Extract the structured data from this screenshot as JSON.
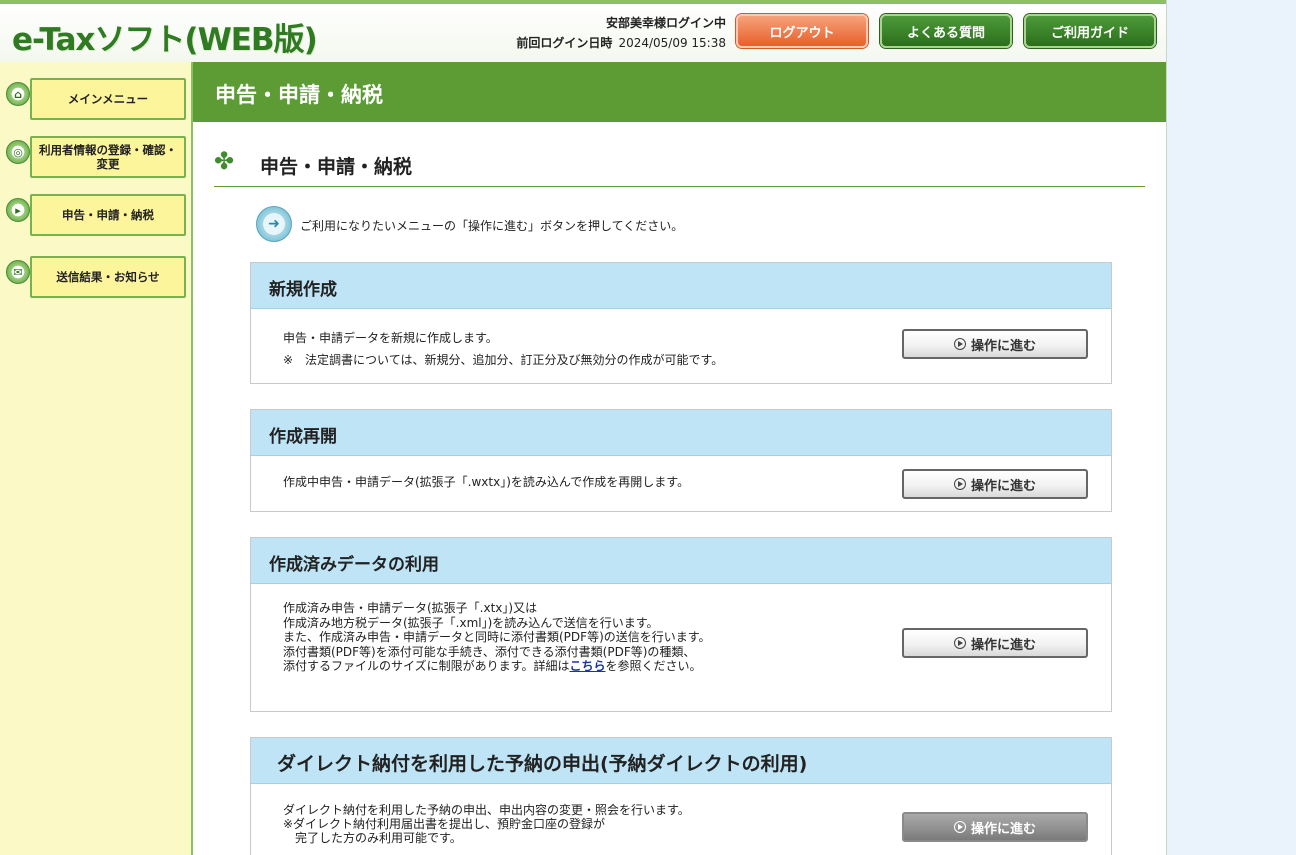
{
  "header": {
    "logo": "e-Taxソフト(WEB版)",
    "user_status": "安部美幸様ログイン中",
    "last_login_label": "前回ログイン日時",
    "last_login_value": "2024/05/09 15:38",
    "logout_label": "ログアウト",
    "faq_label": "よくある質問",
    "guide_label": "ご利用ガイド"
  },
  "sidebar": {
    "items": [
      {
        "label": "メインメニュー",
        "icon": "home-icon"
      },
      {
        "label": "利用者情報の登録・確認・変更",
        "icon": "user-settings-icon"
      },
      {
        "label": "申告・申請・納税",
        "icon": "document-icon"
      },
      {
        "label": "送信結果・お知らせ",
        "icon": "mail-icon"
      }
    ]
  },
  "main": {
    "title": "申告・申請・納税",
    "section_heading": "申告・申請・納税",
    "instruction": "ご利用になりたいメニューの「操作に進む」ボタンを押してください。",
    "panels": [
      {
        "title": "新規作成",
        "lines": [
          "申告・申請データを新規に作成します。",
          "※　法定調書については、新規分、追加分、訂正分及び無効分の作成が可能です。"
        ],
        "button": "操作に進む"
      },
      {
        "title": "作成再開",
        "lines": [
          "作成中申告・申請データ(拡張子「.wxtx」)を読み込んで作成を再開します。"
        ],
        "button": "操作に進む"
      },
      {
        "title": "作成済みデータの利用",
        "lines": [
          "作成済み申告・申請データ(拡張子「.xtx」)又は",
          "作成済み地方税データ(拡張子「.xml」)を読み込んで送信を行います。",
          "また、作成済み申告・申請データと同時に添付書類(PDF等)の送信を行います。",
          "添付書類(PDF等)を添付可能な手続き、添付できる添付書類(PDF等)の種類、"
        ],
        "last_line_prefix": "添付するファイルのサイズに制限があります。詳細は",
        "link_text": "こちら",
        "last_line_suffix": "を参照ください。",
        "button": "操作に進む"
      },
      {
        "title": "ダイレクト納付を利用した予納の申出(予納ダイレクトの利用)",
        "lines": [
          "ダイレクト納付を利用した予納の申出、申出内容の変更・照会を行います。",
          "※ダイレクト納付利用届出書を提出し、預貯金口座の登録が",
          "　完了した方のみ利用可能です。"
        ],
        "button": "操作に進む",
        "button_state": "disabled"
      }
    ]
  },
  "colors": {
    "header_green": "#5d9b35",
    "panel_head_blue": "#bfe4f6",
    "sidebar_yellow": "#fcf59b",
    "logout_orange": "#e85f2b"
  }
}
